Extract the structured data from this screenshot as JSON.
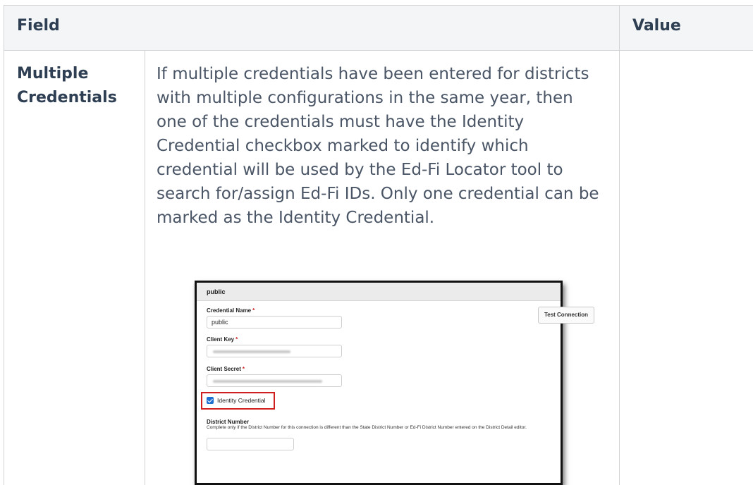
{
  "table": {
    "headers": [
      "Field",
      "",
      "Value"
    ],
    "rows": [
      {
        "field": "Multiple Credentials",
        "description": "If multiple credentials have been entered for districts with multiple configurations in the same year, then one of the credentials must have the Identity Credential checkbox marked to identify which credential will be used by the Ed-Fi Locator tool to search for/assign Ed-Fi IDs. Only one credential can be marked as the Identity Credential.",
        "value": ""
      }
    ]
  },
  "screenshot": {
    "section_title": "public",
    "credential_name_label": "Credential Name",
    "credential_name_value": "public",
    "client_key_label": "Client Key",
    "client_secret_label": "Client Secret",
    "required_marker": "*",
    "test_connection_label": "Test Connection",
    "identity_credential_label": "Identity Credential",
    "identity_credential_checked": true,
    "district_number_label": "District Number",
    "district_number_help": "Complete only if the District Number for this connection is different than the State District Number or Ed-Fi District Number entered on the District Detail editor.",
    "district_number_value": "",
    "highlight_color": "#d11f1f",
    "checkbox_color": "#1e6fd0"
  }
}
